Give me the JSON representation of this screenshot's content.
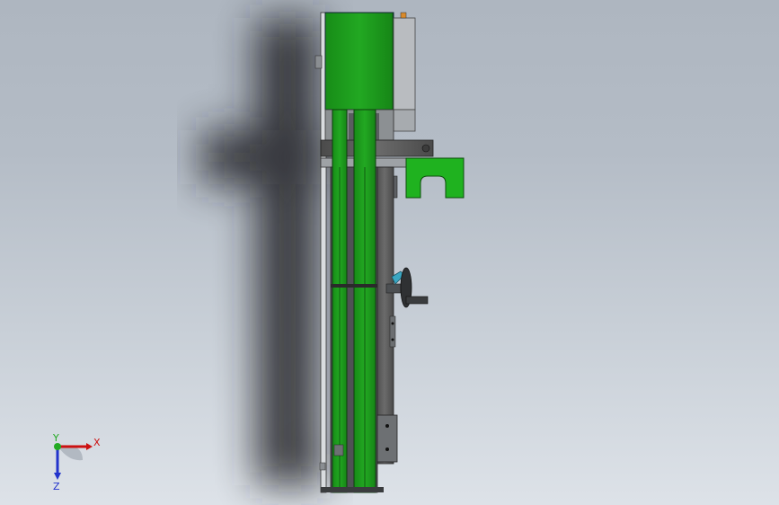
{
  "viewport": {
    "background_top": "#aeb6c0",
    "background_bottom": "#dde2e8"
  },
  "model": {
    "body_color": "#1e9e1e",
    "frame_color": "#5d5d5d",
    "light_panel_color": "#b9bcc0"
  },
  "triad": {
    "x_label": "X",
    "y_label": "Y",
    "z_label": "Z",
    "x_color": "#cc1111",
    "y_color": "#22aa22",
    "z_color": "#2233cc"
  }
}
